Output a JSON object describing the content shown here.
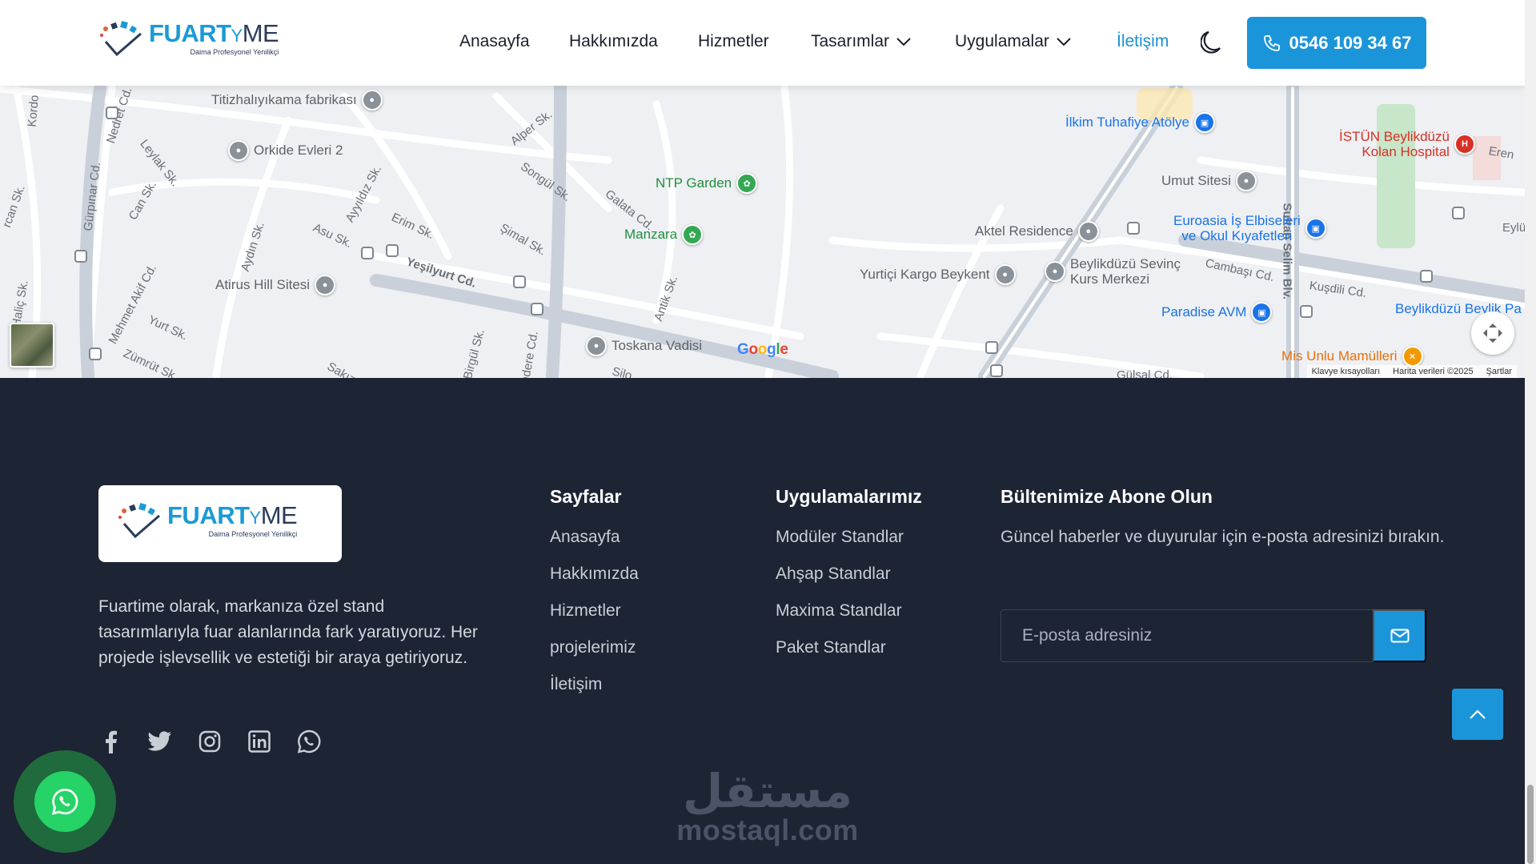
{
  "header": {
    "logo": {
      "brand_main": "FUART",
      "brand_y": "Y",
      "brand_end": "ME",
      "tagline": "Daima Profesyonel Yenilikçi"
    },
    "nav": [
      {
        "label": "Anasayfa"
      },
      {
        "label": "Hakkımızda"
      },
      {
        "label": "Hizmetler"
      },
      {
        "label": "Tasarımlar"
      },
      {
        "label": "Uygulamalar"
      },
      {
        "label": "İletişim"
      }
    ],
    "phone": "0546 109 34 67"
  },
  "map": {
    "pois": [
      "Titizhalıyıkama fabrikası",
      "Orkide Evleri 2",
      "NTP Garden",
      "Manzara",
      "Atirus Hill Sitesi",
      "Toskana Vadisi",
      "İlkim Tuhafiye Atölye",
      "İSTÜN Beylikdüzü",
      "Kolan Hospital",
      "Umut Sitesi",
      "Euroasia İş Elbiseleri",
      "ve Okul Kıyafetleri",
      "Aktel Residence",
      "Yurtiçi Kargo Beykent",
      "Beylikdüzü Sevinç",
      "Kurs Merkezi",
      "Paradise AVM",
      "Mis Unlu Mamülleri",
      "Beylikdüzü Beylik Pa"
    ],
    "streets": [
      "Nedret Cd.",
      "Leylak Sk.",
      "Can Sk.",
      "Gürpınar Cd.",
      "Mehmet Akif Cd.",
      "Yurt Sk.",
      "Zümrüt Sk.",
      "Aydın Sk.",
      "Asu Sk.",
      "Ayyıldız Sk.",
      "Erim Sk.",
      "Alper Sk.",
      "Songül Sk.",
      "Galata Cd.",
      "Şimal Sk.",
      "Yeşilyurt Cd.",
      "Antik Sk.",
      "Birgül Sk.",
      "Sakız Sk.",
      "Sultan Selim Blv.",
      "Cambaşı Cd.",
      "Kuşdili Cd.",
      "Kordo",
      "Haliç Sk.",
      "Eren",
      "Eylü",
      "ndere Cd.",
      "Silo",
      "Gülsal Cd.",
      "rcan Sk."
    ],
    "google_letters": [
      "G",
      "o",
      "o",
      "g",
      "l",
      "e"
    ],
    "footer": [
      "Klavye kısayolları",
      "Harita verileri ©2025",
      "Şartlar"
    ]
  },
  "footer": {
    "about": "Fuartime olarak, markanıza özel stand tasarımlarıyla fuar alanlarında fark yaratıyoruz. Her projede işlevsellik ve estetiği bir araya getiriyoruz.",
    "pages": {
      "title": "Sayfalar",
      "links": [
        "Anasayfa",
        "Hakkımızda",
        "Hizmetler",
        "projelerimiz",
        "İletişim"
      ]
    },
    "apps": {
      "title": "Uygulamalarımız",
      "links": [
        "Modüler Standlar",
        "Ahşap Standlar",
        "Maxima Standlar",
        "Paket Standlar"
      ]
    },
    "newsletter": {
      "title": "Bültenimize Abone Olun",
      "desc": "Güncel haberler ve duyurular için e-posta adresinizi bırakın.",
      "placeholder": "E-posta adresiniz"
    },
    "social": [
      "facebook-icon",
      "twitter-icon",
      "instagram-icon",
      "linkedin-icon",
      "whatsapp-icon"
    ]
  },
  "watermark": {
    "arabic": "مستقل",
    "latin": "mostaql.com"
  },
  "colors": {
    "accent": "#1b95d9",
    "footer_bg": "#1d2433",
    "map_bg": "#eef0f3",
    "whatsapp": "#25d366"
  }
}
